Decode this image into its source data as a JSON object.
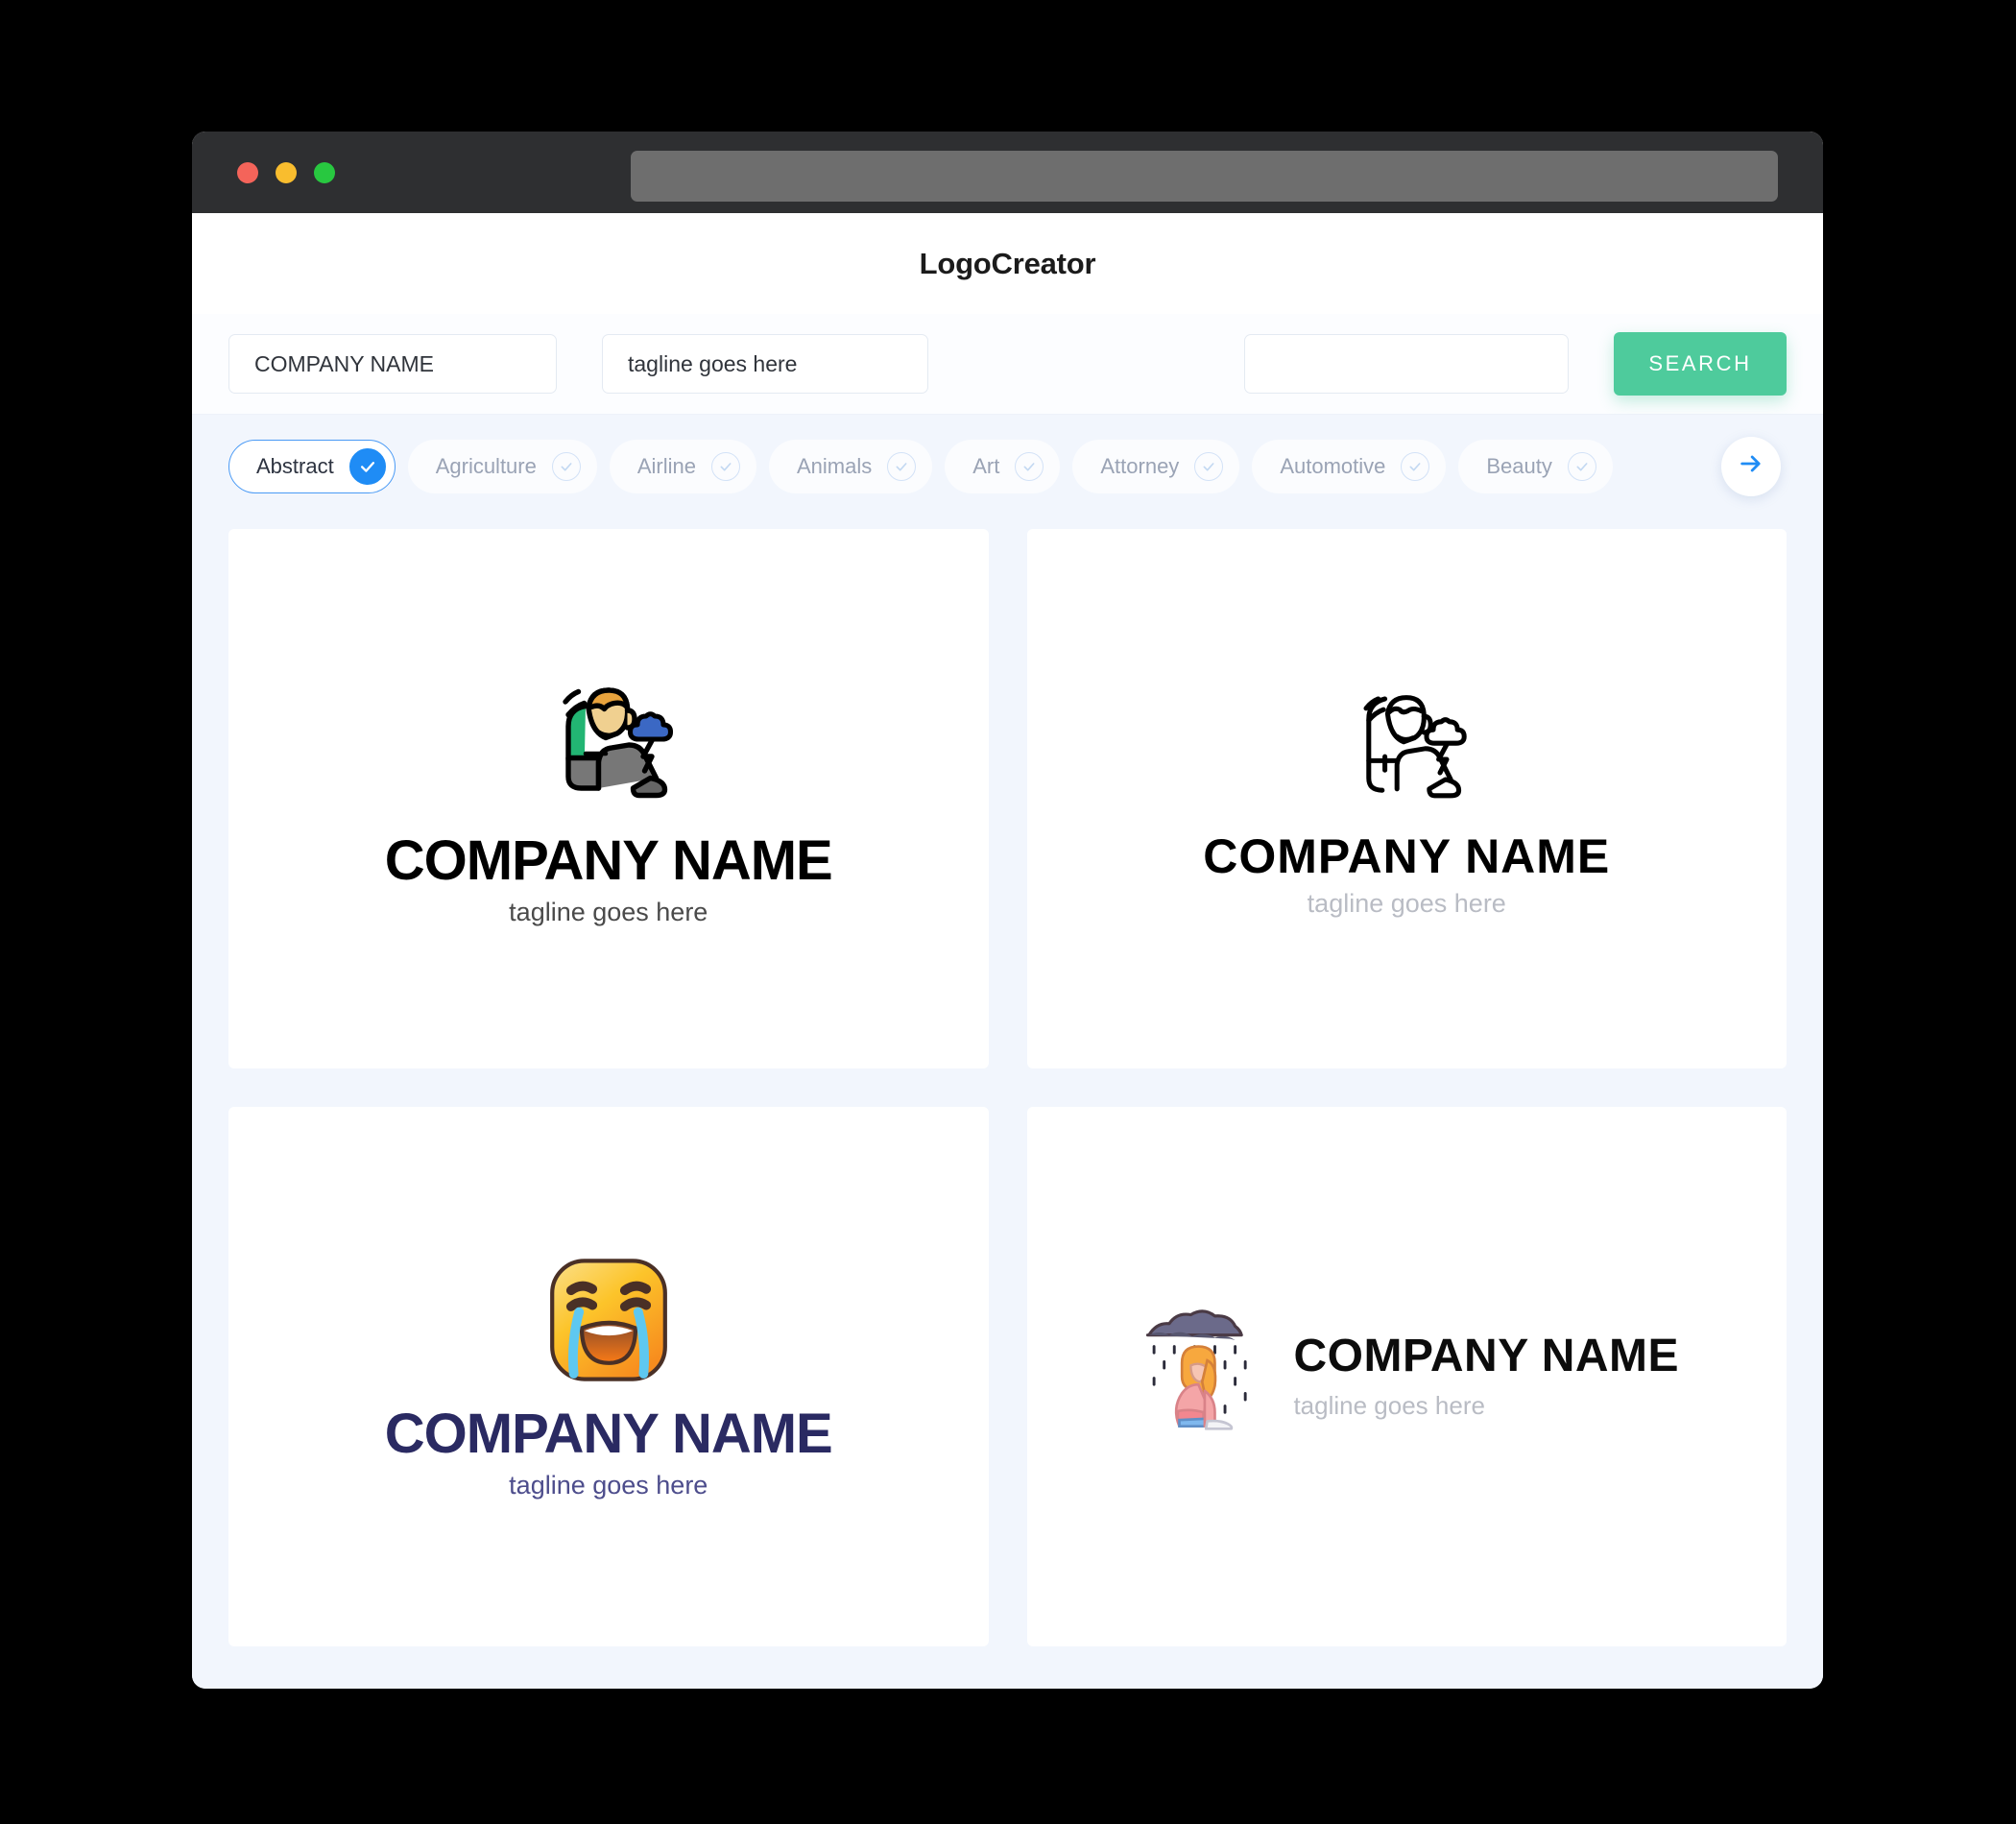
{
  "window": {
    "traffic_lights": [
      "close",
      "minimize",
      "maximize"
    ],
    "url_value": ""
  },
  "header": {
    "app_title": "LogoCreator"
  },
  "search": {
    "company_value": "COMPANY NAME",
    "company_placeholder": "COMPANY NAME",
    "tagline_value": "tagline goes here",
    "tagline_placeholder": "tagline goes here",
    "keyword_value": "",
    "keyword_placeholder": "",
    "search_button": "SEARCH",
    "search_button_color": "#4ecb9c"
  },
  "categories": {
    "selected": "Abstract",
    "accent_color": "#1f8cf5",
    "next_label": "next",
    "items": [
      {
        "label": "Abstract",
        "selected": true
      },
      {
        "label": "Agriculture",
        "selected": false
      },
      {
        "label": "Airline",
        "selected": false
      },
      {
        "label": "Animals",
        "selected": false
      },
      {
        "label": "Art",
        "selected": false
      },
      {
        "label": "Attorney",
        "selected": false
      },
      {
        "label": "Automotive",
        "selected": false
      },
      {
        "label": "Beauty",
        "selected": false
      }
    ]
  },
  "results": [
    {
      "icon": "sad-person-storm-cloud-color-icon",
      "layout": "stacked",
      "name": "COMPANY NAME",
      "tagline": "tagline goes here",
      "name_color": "#000000",
      "tagline_color": "#4a4a4a"
    },
    {
      "icon": "sad-person-storm-cloud-outline-icon",
      "layout": "stacked",
      "name": "COMPANY NAME",
      "tagline": "tagline goes here",
      "name_color": "#000000",
      "tagline_color": "#b9bcc4"
    },
    {
      "icon": "crying-face-emoji-icon",
      "layout": "stacked",
      "name": "COMPANY NAME",
      "tagline": "tagline goes here",
      "name_color": "#2a2a62",
      "tagline_color": "#4d4d8c"
    },
    {
      "icon": "sad-girl-rain-cloud-icon",
      "layout": "horizontal",
      "name": "COMPANY NAME",
      "tagline": "tagline goes here",
      "name_color": "#0c0c0c",
      "tagline_color": "#b9bcc4"
    }
  ]
}
